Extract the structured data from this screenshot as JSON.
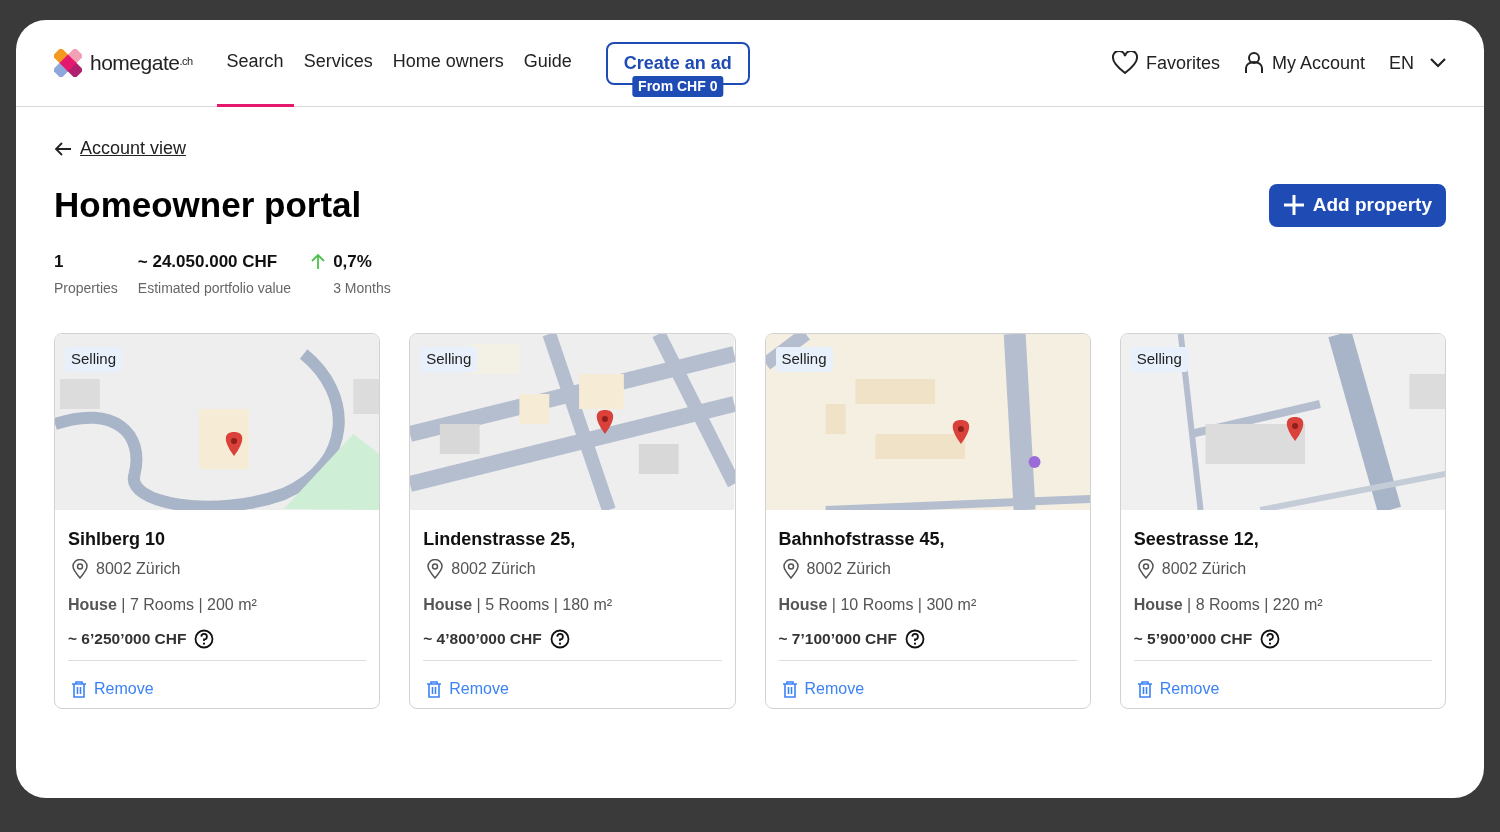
{
  "header": {
    "logo": "homegate$^{.ch}$",
    "nav": [
      {
        "label": "Search",
        "selected": true
      },
      {
        "label": "Services",
        "selected": false
      },
      {
        "label": "Home owners",
        "selected": false
      },
      {
        "label": "Guide",
        "selected": false
      }
    ],
    "create_ad": {
      "label": "Create an ad",
      "badge": "From CHF 0"
    },
    "favorites": "Favorites",
    "account": "My Account",
    "language": "EN"
  },
  "back_link": "Account view",
  "title": "Homeowner portal",
  "add_button": "Add property",
  "stats": [
    {
      "value": "1",
      "label": "Properties",
      "rising": false
    },
    {
      "value": "~ 24.050.000 CHF",
      "label": "Estimated portfolio value",
      "rising": false
    },
    {
      "value": "0,7%",
      "label": "3 Months",
      "rising": true
    }
  ],
  "properties": [
    {
      "status": "Selling",
      "name": "Sihlberg 10",
      "city": "8002 Zürich",
      "specs": "**House** | 7 Rooms | 200 m²",
      "price": "~ 6’250’000 CHF",
      "remove": "Remove"
    },
    {
      "status": "Selling",
      "name": "Lindenstrasse 25,",
      "city": "8002 Zürich",
      "specs": "**House** | 5 Rooms | 180 m²",
      "price": "~ 4’800’000 CHF",
      "remove": "Remove"
    },
    {
      "status": "Selling",
      "name": "Bahnhofstrasse 45,",
      "city": "8002 Zürich",
      "specs": "**House** | 10 Rooms | 300 m²",
      "price": "~ 7’100’000 CHF",
      "remove": "Remove"
    },
    {
      "status": "Selling",
      "name": "Seestrasse 12,",
      "city": "8002 Zürich",
      "specs": "**House** | 8 Rooms | 220 m²",
      "price": "~ 5’900’000 CHF",
      "remove": "Remove"
    }
  ]
}
